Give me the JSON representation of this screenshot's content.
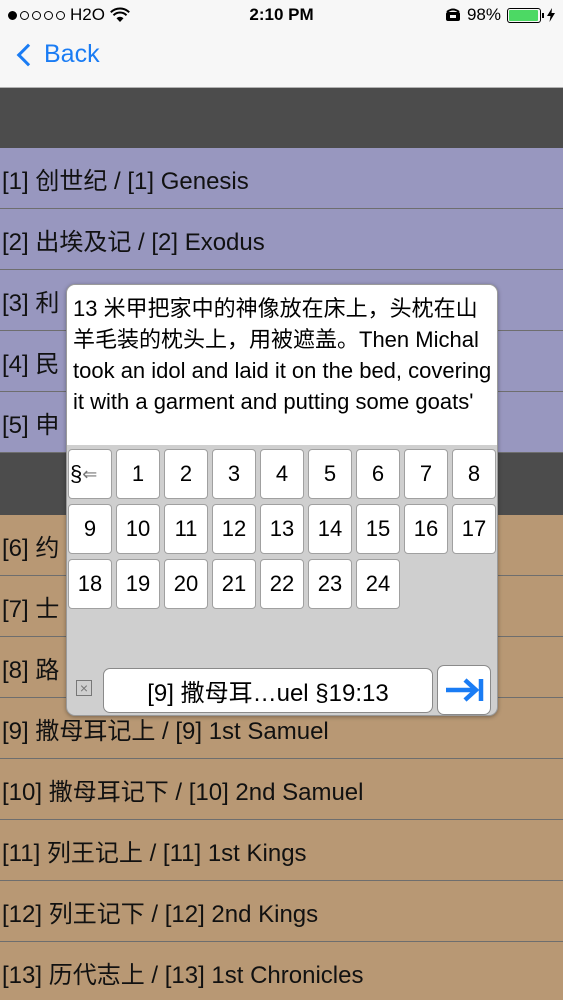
{
  "status": {
    "carrier": "H2O",
    "time": "2:10 PM",
    "battery_percent": "98%",
    "signal_bars_filled": 1,
    "signal_bars_total": 5,
    "battery_level": 0.98,
    "battery_color": "#4cd964"
  },
  "nav": {
    "back_label": "Back",
    "accent": "#1a7cf4"
  },
  "books": [
    {
      "label": "[1] 创世纪 / [1] Genesis",
      "color": "purple"
    },
    {
      "label": "[2] 出埃及记 / [2] Exodus",
      "color": "purple"
    },
    {
      "label": "[3] 利",
      "color": "purple"
    },
    {
      "label": "[4] 民",
      "color": "purple"
    },
    {
      "label": "[5] 申",
      "color": "purple"
    },
    {
      "label": "",
      "color": "band"
    },
    {
      "label": "[6] 约",
      "color": "tan"
    },
    {
      "label": "[7] 士",
      "color": "tan"
    },
    {
      "label": "[8] 路",
      "color": "tan"
    },
    {
      "label": "[9] 撒母耳记上 / [9] 1st Samuel",
      "color": "tan"
    },
    {
      "label": "[10] 撒母耳记下 / [10] 2nd Samuel",
      "color": "tan"
    },
    {
      "label": "[11] 列王记上 / [11] 1st Kings",
      "color": "tan"
    },
    {
      "label": "[12] 列王记下 / [12] 2nd Kings",
      "color": "tan"
    },
    {
      "label": "[13] 历代志上 / [13] 1st Chronicles",
      "color": "tan"
    }
  ],
  "colors": {
    "old_testament_history": "#9897bf",
    "history_books": "#b89874",
    "band": "#4c4c4c"
  },
  "popup": {
    "verse_text": "13 米甲把家中的神像放在床上，头枕在山羊毛装的枕头上，用被遮盖。Then Michal took an idol and laid it on the bed, covering it with a garment and putting some goats'",
    "section_key": "§",
    "verse_keys": [
      "1",
      "2",
      "3",
      "4",
      "5",
      "6",
      "7",
      "8",
      "9",
      "10",
      "11",
      "12",
      "13",
      "14",
      "15",
      "16",
      "17",
      "18",
      "19",
      "20",
      "21",
      "22",
      "23",
      "24"
    ],
    "reference": "[9] 撒母耳…uel §19:13",
    "clear_icon": "clear-x-icon",
    "go_icon": "arrow-to-bar-icon",
    "go_color": "#1a7cf4"
  }
}
